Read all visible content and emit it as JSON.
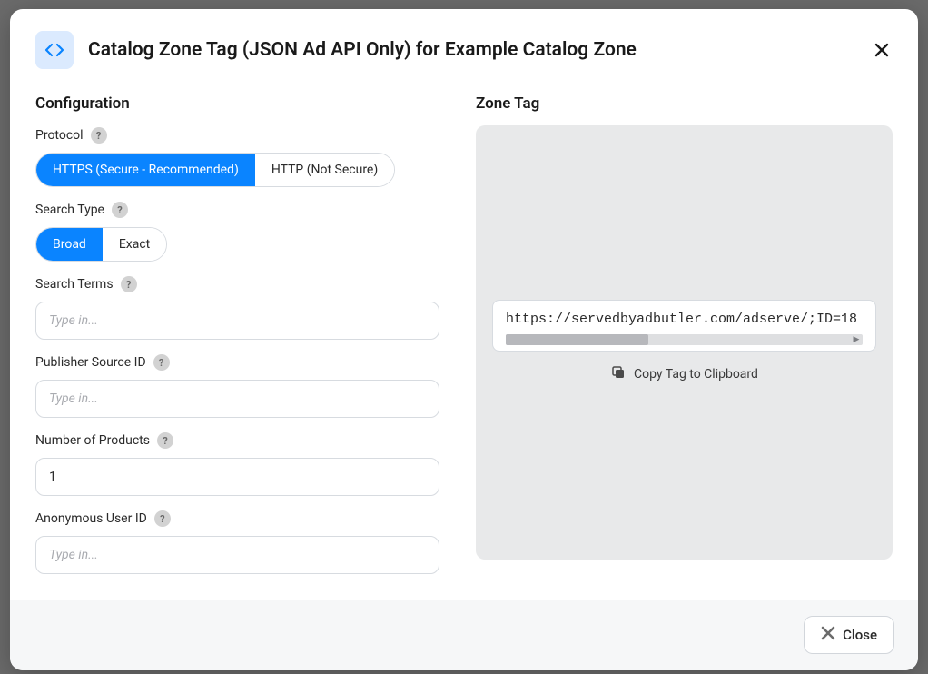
{
  "modal": {
    "title": "Catalog Zone Tag (JSON Ad API Only) for Example Catalog Zone"
  },
  "config": {
    "heading": "Configuration",
    "protocol": {
      "label": "Protocol",
      "options": [
        "HTTPS (Secure - Recommended)",
        "HTTP (Not Secure)"
      ],
      "selected": 0
    },
    "searchType": {
      "label": "Search Type",
      "options": [
        "Broad",
        "Exact"
      ],
      "selected": 0
    },
    "searchTerms": {
      "label": "Search Terms",
      "placeholder": "Type in...",
      "value": ""
    },
    "publisherSourceId": {
      "label": "Publisher Source ID",
      "placeholder": "Type in...",
      "value": ""
    },
    "numberOfProducts": {
      "label": "Number of Products",
      "placeholder": "",
      "value": "1"
    },
    "anonymousUserId": {
      "label": "Anonymous User ID",
      "placeholder": "Type in...",
      "value": ""
    }
  },
  "zoneTag": {
    "heading": "Zone Tag",
    "code": "https://servedbyadbutler.com/adserve/;ID=18",
    "copyLabel": "Copy Tag to Clipboard"
  },
  "footer": {
    "closeLabel": "Close"
  }
}
